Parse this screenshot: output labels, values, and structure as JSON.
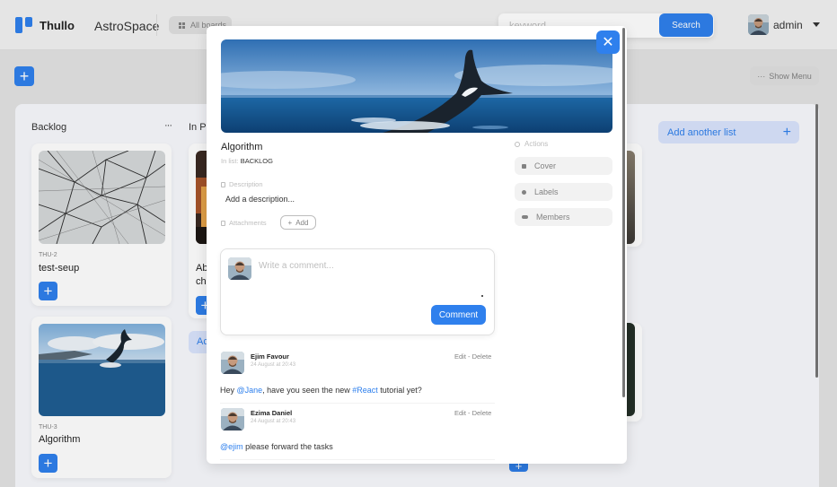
{
  "header": {
    "logo": "Thullo",
    "board_name": "AstroSpace",
    "all_boards": "All boards",
    "search_placeholder": "keyword",
    "search_button": "Search",
    "user_name": "admin"
  },
  "toolbar": {
    "show_menu": "Show Menu"
  },
  "lists": [
    {
      "title": "Backlog",
      "cards": [
        {
          "code": "THU-2",
          "title": "test-seup"
        },
        {
          "code": "THU-3",
          "title": "Algorithm"
        }
      ]
    },
    {
      "title": "In P",
      "cards": [
        {
          "title_line1": "Ab",
          "title_line2": "ch"
        }
      ],
      "add_card": "Ac"
    }
  ],
  "add_another_list": "Add another list",
  "modal": {
    "title": "Algorithm",
    "in_list_label": "In list:",
    "in_list_value": "BACKLOG",
    "description_label": "Description",
    "description_placeholder": "Add a description...",
    "attachments_label": "Attachments",
    "add_attachment": "Add",
    "actions_label": "Actions",
    "actions": [
      {
        "label": "Cover",
        "icon": "image-icon"
      },
      {
        "label": "Labels",
        "icon": "label-icon"
      },
      {
        "label": "Members",
        "icon": "people-icon"
      }
    ],
    "comment_placeholder": "Write a comment...",
    "comment_button": "Comment",
    "comments": [
      {
        "author": "Ejim Favour",
        "date": "24 August at 20:43",
        "actions": "Edit - Delete",
        "text_before": "Hey ",
        "mention": "@Jane",
        "text_mid": ", have you seen the new ",
        "mention2": "#React",
        "text_after": " tutorial yet?"
      },
      {
        "author": "Ezima Daniel",
        "date": "24 August at 20:43",
        "actions": "Edit - Delete",
        "mention": "@ejim",
        "text_after": " please forward the tasks"
      }
    ]
  },
  "colors": {
    "accent": "#2f80ed",
    "muted": "#828282",
    "light_muted": "#bdbdbd",
    "add_list_bg": "#dae4fd"
  }
}
